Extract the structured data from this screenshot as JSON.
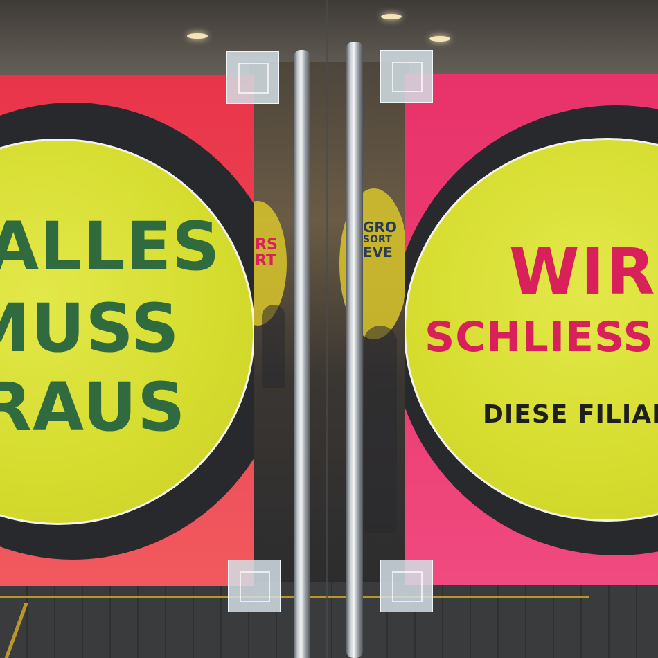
{
  "left_poster": {
    "line1": "ALLES",
    "line2": "MUSS",
    "line3": "RAUS"
  },
  "right_poster": {
    "line1": "WIR",
    "line2": "SCHLIESS",
    "line3": "DIESE FILIAL"
  },
  "background_posters": {
    "left_mini": [
      "RS",
      "RT"
    ],
    "right_mini": [
      "GRO",
      "SORT",
      "EVE"
    ]
  },
  "colors": {
    "poster_left_red": "#e9344a",
    "poster_right_pink": "#e8336a",
    "disc_yellow": "#d6dd2f",
    "text_green": "#2f6b3f",
    "text_pink": "#d8205a",
    "text_black": "#1f1f1f",
    "handle_steel": "#c9ced2"
  }
}
